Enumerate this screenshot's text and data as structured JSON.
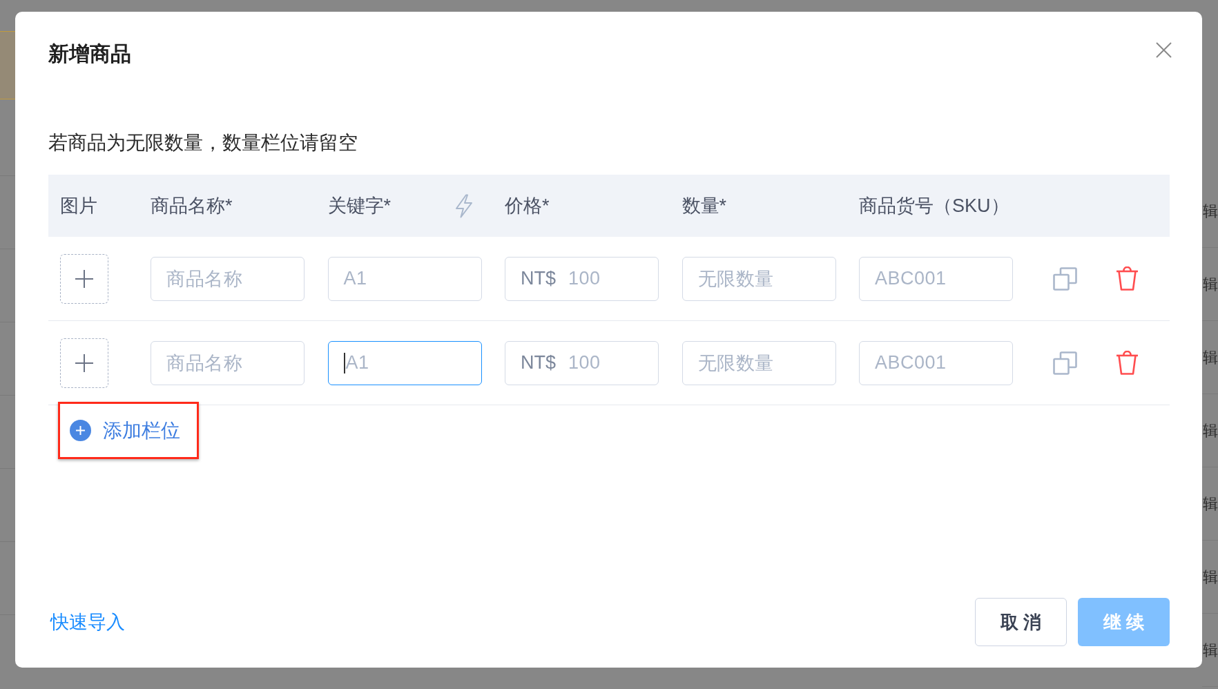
{
  "background": {
    "row_actions": [
      "辑",
      "辑",
      "辑",
      "辑",
      "辑",
      "辑",
      "辑"
    ]
  },
  "dialog": {
    "title": "新增商品",
    "hint": "若商品为无限数量，数量栏位请留空",
    "table": {
      "columns": [
        {
          "label": "图片",
          "kind": "image"
        },
        {
          "label": "商品名称*",
          "kind": "name"
        },
        {
          "label": "关键字*",
          "kind": "keyword"
        },
        {
          "label": "价格*",
          "kind": "price"
        },
        {
          "label": "数量*",
          "kind": "quantity"
        },
        {
          "label": "商品货号（SKU）",
          "kind": "sku"
        }
      ],
      "rows": [
        {
          "cells": [
            {
              "kind": "upload"
            },
            {
              "kind": "input",
              "placeholder": "商品名称",
              "focused": false
            },
            {
              "kind": "input",
              "placeholder": "A1",
              "focused": false
            },
            {
              "kind": "input",
              "prefix": "NT$",
              "placeholder": "100",
              "focused": false
            },
            {
              "kind": "input",
              "placeholder": "无限数量",
              "focused": false
            },
            {
              "kind": "input",
              "placeholder": "ABC001",
              "focused": false
            }
          ]
        },
        {
          "cells": [
            {
              "kind": "upload"
            },
            {
              "kind": "input",
              "placeholder": "商品名称",
              "focused": false
            },
            {
              "kind": "input",
              "placeholder": "A1",
              "focused": true
            },
            {
              "kind": "input",
              "prefix": "NT$",
              "placeholder": "100",
              "focused": false
            },
            {
              "kind": "input",
              "placeholder": "无限数量",
              "focused": false
            },
            {
              "kind": "input",
              "placeholder": "ABC001",
              "focused": false
            }
          ]
        }
      ]
    },
    "add_row": {
      "label": "添加栏位",
      "highlighted": true
    },
    "import_link": "快速导入",
    "buttons": [
      {
        "label": "取 消",
        "kind": "default",
        "disabled": false
      },
      {
        "label": "继 续",
        "kind": "primary",
        "disabled": true
      }
    ]
  }
}
